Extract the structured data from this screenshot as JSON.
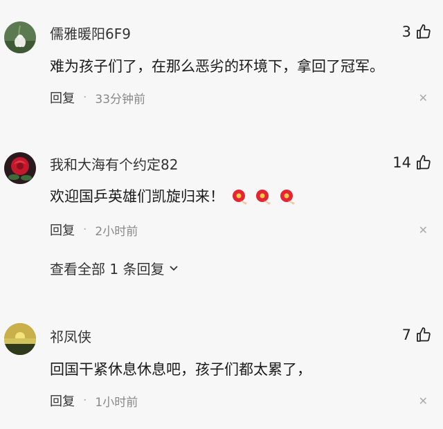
{
  "comments": [
    {
      "username": "儒雅暖阳6F9",
      "text": "难为孩子们了，在那么恶劣的环境下，拿回了冠军。",
      "likes": "3",
      "reply_label": "回复",
      "time": "33分钟前",
      "avatar_icon": "snowdrop-flower-avatar"
    },
    {
      "username": "我和大海有个约定82",
      "text": "欢迎国乒英雄们凯旋归来！",
      "likes": "14",
      "reply_label": "回复",
      "time": "2小时前",
      "emoji_icon": "flower-emoji",
      "emoji_count": 3,
      "avatar_icon": "red-rose-avatar",
      "view_replies": "查看全部 1 条回复"
    },
    {
      "username": "祁凤侠",
      "text": "回国干紧休息休息吧，孩子们都太累了，",
      "likes": "7",
      "reply_label": "回复",
      "time": "1小时前",
      "avatar_icon": "sunset-lake-avatar"
    }
  ],
  "icons": {
    "like": "thumbs-up-icon",
    "close": "close-icon",
    "expand": "chevron-down-icon"
  },
  "colors": {
    "background": "#f7f7f7",
    "text": "#1a1a1a",
    "meta": "#888888"
  }
}
